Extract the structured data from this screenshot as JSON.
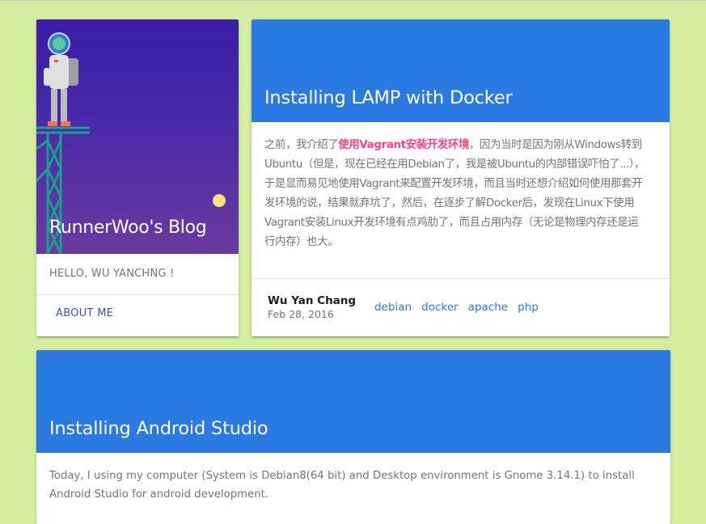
{
  "profile": {
    "blog_title": "RunnerWoo's Blog",
    "greeting": "HELLO, WU YANCHNG !",
    "about_label": "ABOUT ME"
  },
  "posts": [
    {
      "title": "Installing LAMP with Docker",
      "excerpt_before": "之前，我介绍了",
      "excerpt_link": "使用Vagrant安装开发环境",
      "excerpt_after": "，因为当时是因为刚从Windows转到Ubuntu（但是，现在已经在用Debian了，我是被Ubuntu的内部错误吓怕了...），于是显而易见地使用Vagrant来配置开发环境，而且当时还想介绍如何使用那套开发环境的说，结果就弃坑了，然后，在逐步了解Docker后，发现在Linux下使用Vagrant安装Linux开发环境有点鸡肋了，而且占用内存（无论是物理内存还是运行内存）也大。",
      "author": "Wu Yan Chang",
      "date": "Feb 28, 2016",
      "tags": [
        "debian",
        "docker",
        "apache",
        "php"
      ]
    },
    {
      "title": "Installing Android Studio",
      "excerpt": "Today, I using my computer (System is Debian8(64 bit) and Desktop environment is Gnome 3.14.1) to install Android Studio for android development."
    }
  ],
  "colors": {
    "page_background": "#d4ee9f",
    "header_blue": "#2a7ae2",
    "link_pink": "#ff4081",
    "accent_indigo": "#3f51b5"
  }
}
